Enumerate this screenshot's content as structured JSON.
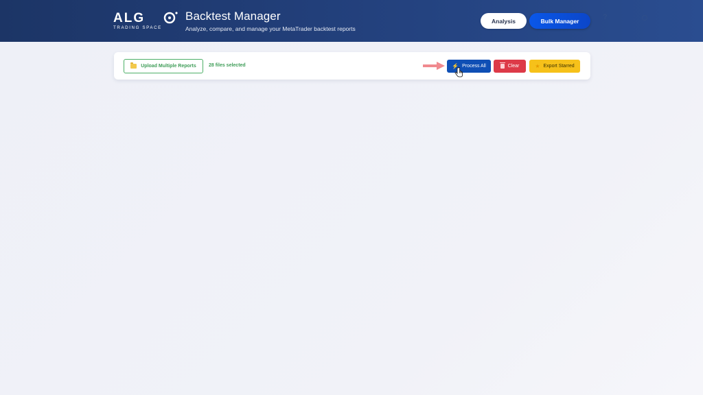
{
  "header": {
    "logo_text": "ALGO TRADING SPACE",
    "title": "Backtest Manager",
    "subtitle": "Analyze, compare, and manage your MetaTrader backtest reports",
    "nav": {
      "analysis_label": "Analysis",
      "bulk_manager_label": "Bulk Manager"
    }
  },
  "toolbar": {
    "upload_label": "Upload Multiple Reports",
    "upload_icon": "folder-icon",
    "files_selected": "28 files selected",
    "process_label": "Process All",
    "process_icon": "bolt-icon",
    "clear_label": "Clear",
    "clear_icon": "trash-icon",
    "export_label": "Export Starred",
    "export_icon": "star-icon"
  },
  "colors": {
    "header_bg": "#223f7a",
    "accent_blue": "#0a57e8",
    "process_blue": "#0f4fb5",
    "success_green": "#3f9d58",
    "danger_red": "#dd3a48",
    "warning_yellow": "#f6c11a",
    "arrow_pink": "#f08a8f"
  }
}
